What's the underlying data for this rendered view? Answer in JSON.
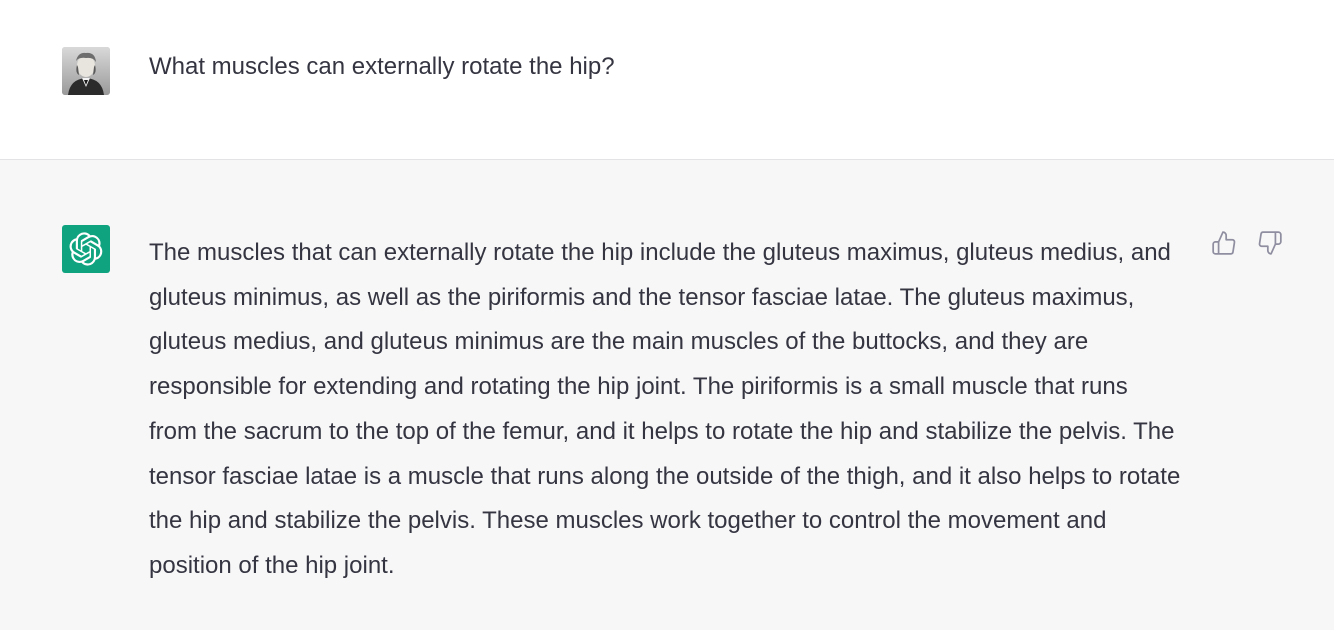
{
  "conversation": {
    "user_message": {
      "avatar_icon": "user-portrait-avatar",
      "text": "What muscles can externally rotate the hip?"
    },
    "assistant_message": {
      "avatar_icon": "openai-logo-icon",
      "avatar_color": "#10a37f",
      "text": "The muscles that can externally rotate the hip include the gluteus maximus, gluteus medius, and gluteus minimus, as well as the piriformis and the tensor fasciae latae. The gluteus maximus, gluteus medius, and gluteus minimus are the main muscles of the buttocks, and they are responsible for extending and rotating the hip joint. The piriformis is a small muscle that runs from the sacrum to the top of the femur, and it helps to rotate the hip and stabilize the pelvis. The tensor fasciae latae is a muscle that runs along the outside of the thigh, and it also helps to rotate the hip and stabilize the pelvis. These muscles work together to control the movement and position of the hip joint.",
      "feedback": {
        "thumbs_up_icon": "thumbs-up-icon",
        "thumbs_down_icon": "thumbs-down-icon"
      }
    }
  },
  "colors": {
    "text": "#343541",
    "assistant_background": "#f7f7f8",
    "user_background": "#ffffff",
    "icon_gray": "#8e8ea0"
  }
}
